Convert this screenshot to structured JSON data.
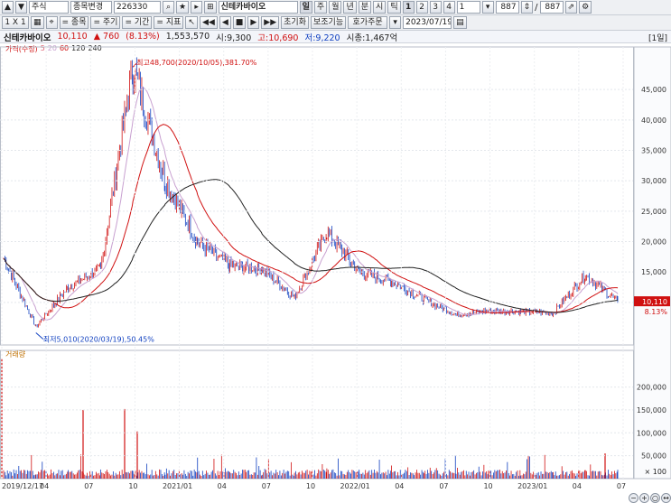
{
  "toolbar1": {
    "market": "주식",
    "change_item": "종목변경",
    "code": "226330",
    "name": "신테카바이오",
    "periods": [
      "일",
      "주",
      "월",
      "년",
      "분",
      "시",
      "틱"
    ],
    "period_nums": [
      "1",
      "2",
      "3",
      "4"
    ],
    "num_input": "1",
    "count_a": "887",
    "slash": "/",
    "count_b": "887"
  },
  "toolbar2": {
    "scale": "1 X 1",
    "item_btns": [
      "= 종목",
      "= 주기",
      "= 기간",
      "= 지표"
    ],
    "reset": "초기화",
    "aux": "보조기능",
    "order": "호가주문",
    "date": "2023/07/19"
  },
  "info": {
    "name": "신테카바이오",
    "price": "10,110",
    "change": "▲ 760",
    "pct": "(8.13%)",
    "volume": "1,553,570",
    "open": "시:9,300",
    "high": "고:10,690",
    "low": "저:9,220",
    "mcap": "시총:1,467억",
    "period": "[1일]"
  },
  "legend": {
    "price": "가격(수정)",
    "ma": [
      "5",
      "20",
      "60",
      "120",
      "240"
    ]
  },
  "annotations": {
    "high": "최고48,700(2020/10/05),381.70%",
    "low": "최저5,010(2020/03/19),50.45%"
  },
  "price_tag": {
    "value": "10,110",
    "pct": "8.13%"
  },
  "volume_label": "거래량",
  "colors": {
    "up": "#d01010",
    "down": "#1040c0",
    "ma5": "#e06070",
    "ma20": "#c8a0d0",
    "ma60": "#d01010",
    "ma120": "#222222",
    "ma240": "#222222"
  },
  "chart_data": [
    {
      "type": "line",
      "title": "",
      "x": [
        "2019/12/17",
        "2020/03/19",
        "2020/06",
        "2020/08",
        "2020/10/05",
        "2020/11",
        "2021/01",
        "2021/03",
        "2021/06",
        "2021/09",
        "2021/12",
        "2022/01",
        "2022/03",
        "2022/06",
        "2022/09",
        "2022/12",
        "2023/02",
        "2023/05",
        "2023/06",
        "2023/07/19"
      ],
      "series": [
        {
          "name": "가격(수정)",
          "values": [
            17200,
            6000,
            12500,
            15500,
            48700,
            30000,
            20000,
            16000,
            15500,
            10800,
            21500,
            15000,
            13500,
            10500,
            8000,
            8600,
            8500,
            8200,
            14500,
            10110
          ]
        }
      ],
      "ylim": [
        3000,
        52000
      ],
      "yticks": [
        "10,000",
        "15,000",
        "20,000",
        "25,000",
        "30,000",
        "35,000",
        "40,000",
        "45,000"
      ],
      "xticks": [
        "2019/12/17",
        "04",
        "07",
        "10",
        "2021/01",
        "04",
        "07",
        "10",
        "2022/01",
        "04",
        "07",
        "10",
        "2023/01",
        "04",
        "07"
      ],
      "ma_periods": [
        "5",
        "20",
        "60",
        "120",
        "240"
      ]
    },
    {
      "type": "bar",
      "title": "거래량",
      "ylim": [
        0,
        280000
      ],
      "yticks": [
        "50,000",
        "100,000",
        "150,000",
        "200,000"
      ],
      "unit": "× 100",
      "peaks": [
        {
          "x": "2019/12/17",
          "value": 262000
        },
        {
          "x": "2020/07",
          "value": 150000
        },
        {
          "x": "2020/08",
          "value": 152000
        },
        {
          "x": "2020/10",
          "value": 103000
        },
        {
          "x": "2023/06",
          "value": 55000
        }
      ]
    }
  ]
}
